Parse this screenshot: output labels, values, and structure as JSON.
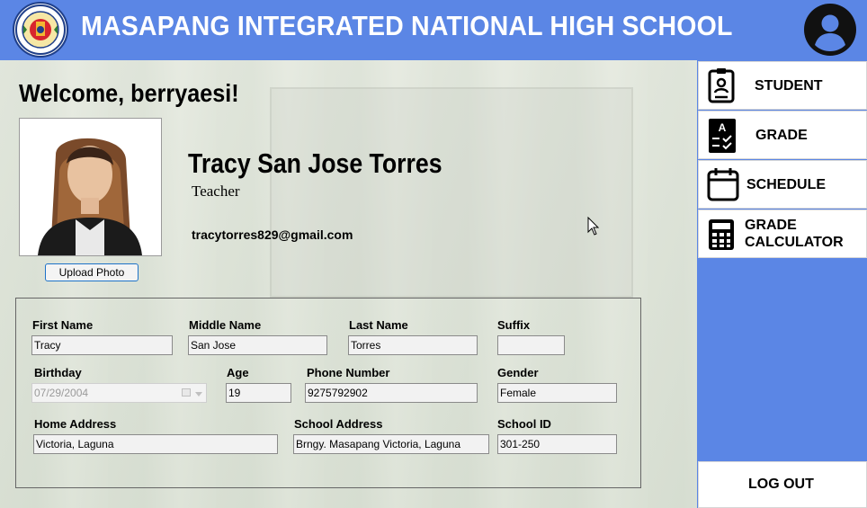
{
  "header": {
    "title": "MASAPANG INTEGRATED NATIONAL HIGH SCHOOL"
  },
  "welcome": "Welcome, berryaesi!",
  "profile": {
    "upload_label": "Upload Photo",
    "name": "Tracy San Jose Torres",
    "role": "Teacher",
    "email": "tracytorres829@gmail.com"
  },
  "form": {
    "first_name_label": "First Name",
    "first_name": "Tracy",
    "middle_name_label": "Middle Name",
    "middle_name": "San Jose",
    "last_name_label": "Last Name",
    "last_name": "Torres",
    "suffix_label": "Suffix",
    "suffix": "",
    "birthday_label": "Birthday",
    "birthday": "07/29/2004",
    "age_label": "Age",
    "age": "19",
    "phone_label": "Phone Number",
    "phone": "9275792902",
    "gender_label": "Gender",
    "gender": "Female",
    "home_address_label": "Home Address",
    "home_address": "Victoria, Laguna",
    "school_address_label": "School Address",
    "school_address": "Brngy. Masapang Victoria, Laguna",
    "school_id_label": "School ID",
    "school_id": "301-250"
  },
  "sidebar": {
    "student": "STUDENT",
    "grade": "GRADE",
    "schedule": "SCHEDULE",
    "calc_line1": "GRADE",
    "calc_line2": "CALCULATOR",
    "logout": "LOG OUT"
  },
  "icons": {
    "logo": "school-seal-icon",
    "avatar": "user-circle-icon",
    "student": "id-badge-icon",
    "grade": "report-card-icon",
    "schedule": "calendar-icon",
    "calculator": "calculator-icon",
    "cursor": "mouse-pointer-icon"
  },
  "colors": {
    "primary_blue": "#5b86e5",
    "white": "#ffffff",
    "text": "#000000"
  }
}
